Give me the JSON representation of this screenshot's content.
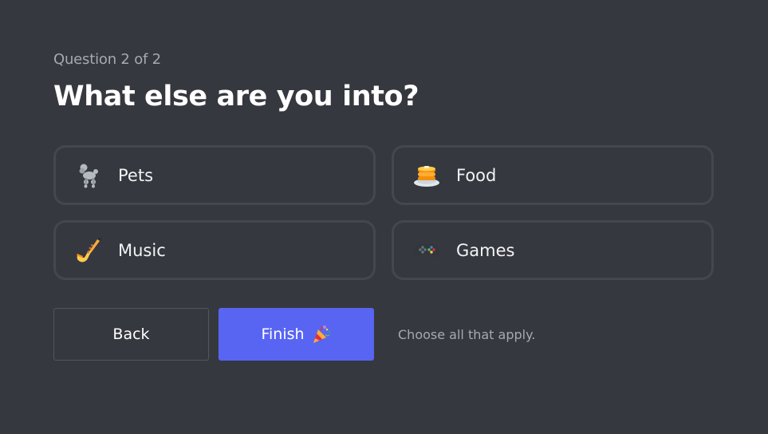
{
  "progress": "Question 2 of 2",
  "title": "What else are you into?",
  "options": [
    {
      "label": "Pets",
      "icon": "poodle-icon"
    },
    {
      "label": "Food",
      "icon": "pancakes-icon"
    },
    {
      "label": "Music",
      "icon": "saxophone-icon"
    },
    {
      "label": "Games",
      "icon": "game-controller-icon"
    }
  ],
  "actions": {
    "back_label": "Back",
    "finish_label": "Finish",
    "finish_icon": "party-popper-icon",
    "hint": "Choose all that apply."
  },
  "colors": {
    "background": "#36383f",
    "option_border": "#45474e",
    "primary": "#5865f2",
    "muted_text": "#a7a9ae"
  }
}
